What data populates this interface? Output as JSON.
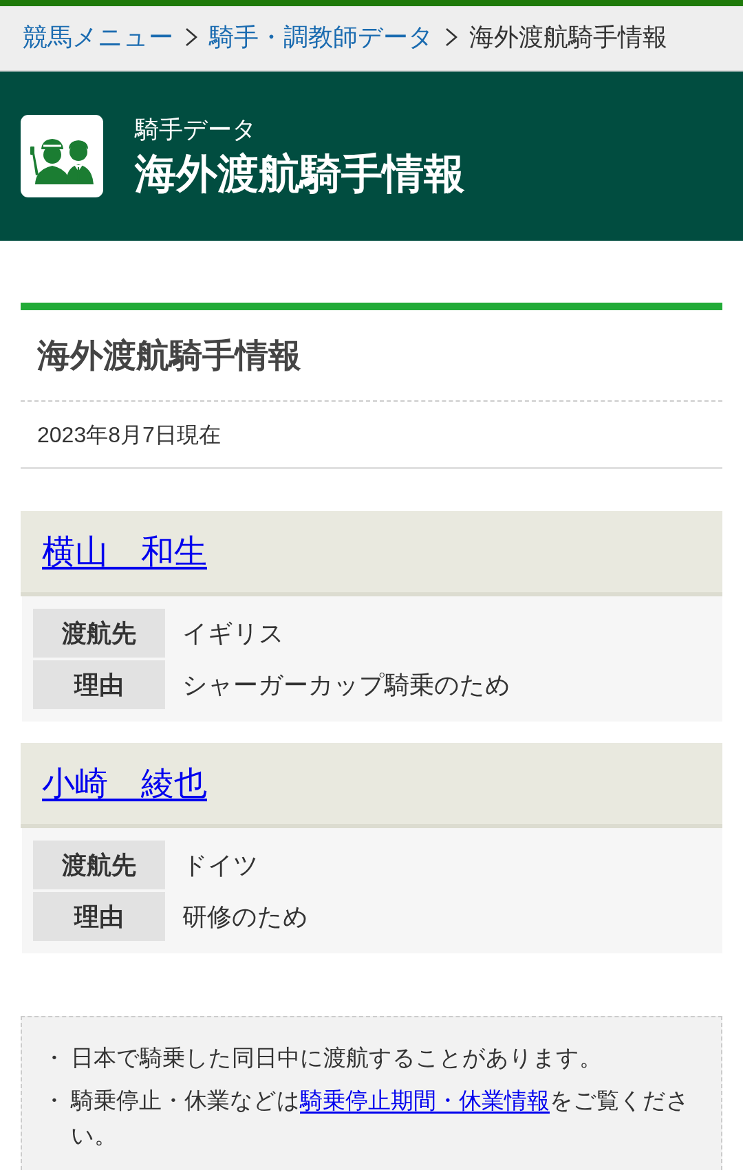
{
  "breadcrumbs": [
    {
      "label": "競馬メニュー",
      "kind": "link"
    },
    {
      "label": "騎手・調教師データ",
      "kind": "link"
    },
    {
      "label": "海外渡航騎手情報",
      "kind": "current"
    }
  ],
  "header": {
    "category": "騎手データ",
    "title": "海外渡航騎手情報"
  },
  "section": {
    "title": "海外渡航騎手情報",
    "date": "2023年8月7日現在"
  },
  "jockeys": [
    {
      "name": "横山　和生",
      "details": [
        {
          "label": "渡航先",
          "value": "イギリス"
        },
        {
          "label": "理由",
          "value": "シャーガーカップ騎乗のため"
        }
      ]
    },
    {
      "name": "小崎　綾也",
      "details": [
        {
          "label": "渡航先",
          "value": "ドイツ"
        },
        {
          "label": "理由",
          "value": "研修のため"
        }
      ]
    }
  ],
  "notes": [
    {
      "marker": "・",
      "parts": [
        {
          "kind": "text",
          "text": "日本で騎乗した同日中に渡航することがあります。"
        }
      ]
    },
    {
      "marker": "・",
      "parts": [
        {
          "kind": "text",
          "text": "騎乗停止・休業などは"
        },
        {
          "kind": "link",
          "text": "騎乗停止期間・休業情報"
        },
        {
          "kind": "text",
          "text": "をご覧ください。"
        }
      ]
    }
  ]
}
